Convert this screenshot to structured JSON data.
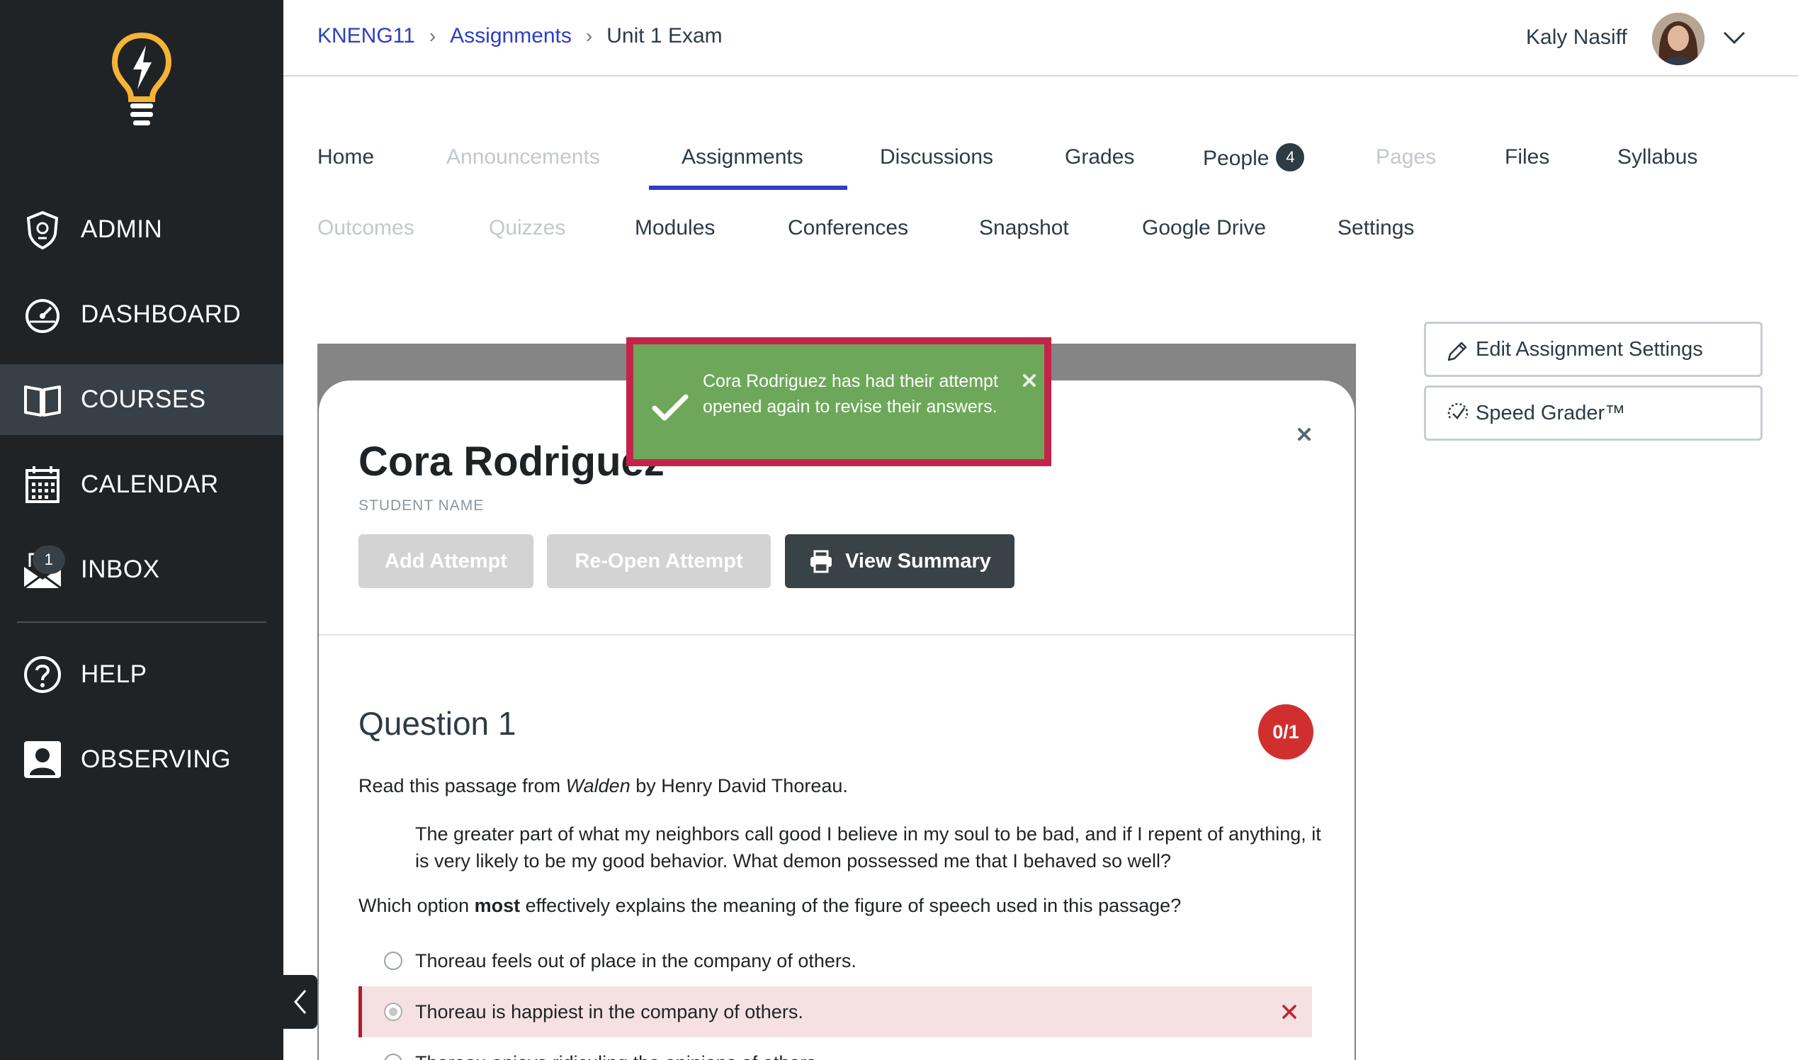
{
  "sidebar": {
    "items": [
      {
        "label": "ADMIN",
        "icon": "admin-shield-icon"
      },
      {
        "label": "DASHBOARD",
        "icon": "dashboard-gauge-icon"
      },
      {
        "label": "COURSES",
        "icon": "book-icon",
        "active": true
      },
      {
        "label": "CALENDAR",
        "icon": "calendar-icon"
      },
      {
        "label": "INBOX",
        "icon": "inbox-icon",
        "badge": "1"
      },
      {
        "label": "HELP",
        "icon": "help-icon"
      },
      {
        "label": "OBSERVING",
        "icon": "observer-icon"
      }
    ]
  },
  "breadcrumb": {
    "course": "KNENG11",
    "section": "Assignments",
    "current": "Unit 1 Exam"
  },
  "user": {
    "name": "Kaly Nasiff"
  },
  "tabs": {
    "row1": [
      {
        "label": "Home",
        "disabled": false
      },
      {
        "label": "Announcements",
        "disabled": true
      },
      {
        "label": "Assignments",
        "disabled": false,
        "active": true
      },
      {
        "label": "Discussions",
        "disabled": false
      },
      {
        "label": "Grades",
        "disabled": false
      },
      {
        "label": "People",
        "disabled": false,
        "badge": "4"
      },
      {
        "label": "Pages",
        "disabled": true
      },
      {
        "label": "Files",
        "disabled": false
      },
      {
        "label": "Syllabus",
        "disabled": false
      }
    ],
    "row2": [
      {
        "label": "Outcomes",
        "disabled": true
      },
      {
        "label": "Quizzes",
        "disabled": true
      },
      {
        "label": "Modules",
        "disabled": false
      },
      {
        "label": "Conferences",
        "disabled": false
      },
      {
        "label": "Snapshot",
        "disabled": false
      },
      {
        "label": "Google Drive",
        "disabled": false
      },
      {
        "label": "Settings",
        "disabled": false
      }
    ]
  },
  "student": {
    "name": "Cora Rodriguez",
    "label": "STUDENT NAME"
  },
  "actions": {
    "add_attempt": "Add Attempt",
    "reopen_attempt": "Re-Open Attempt",
    "view_summary": "View Summary"
  },
  "side_actions": {
    "edit_settings": "Edit Assignment Settings",
    "speed_grader": "Speed Grader™"
  },
  "toast": {
    "message": "Cora Rodriguez has had their attempt opened again to revise their answers."
  },
  "question": {
    "title": "Question 1",
    "score": "0/1",
    "intro_prefix": "Read this passage from ",
    "intro_title": "Walden",
    "intro_suffix": " by Henry David Thoreau.",
    "quote": "The greater part of what my neighbors call good I believe in my soul to be bad, and if I repent of anything, it is very likely to be my good behavior. What demon possessed me that I behaved so well?",
    "prompt_prefix": "Which option ",
    "prompt_bold": "most",
    "prompt_suffix": " effectively explains the meaning of the figure of speech used in this passage?",
    "options": [
      {
        "label": "Thoreau feels out of place in the company of others.",
        "selected": false
      },
      {
        "label": "Thoreau is happiest in the company of others.",
        "selected": true,
        "wrong": true
      },
      {
        "label": "Thoreau enjoys ridiculing the opinions of others.",
        "selected": false
      }
    ]
  },
  "colors": {
    "sidebar_bg": "#1f2326",
    "link": "#2d3ec2",
    "toast_bg": "#6da85a",
    "toast_border": "#c42449",
    "score_badge": "#d12f2f"
  }
}
